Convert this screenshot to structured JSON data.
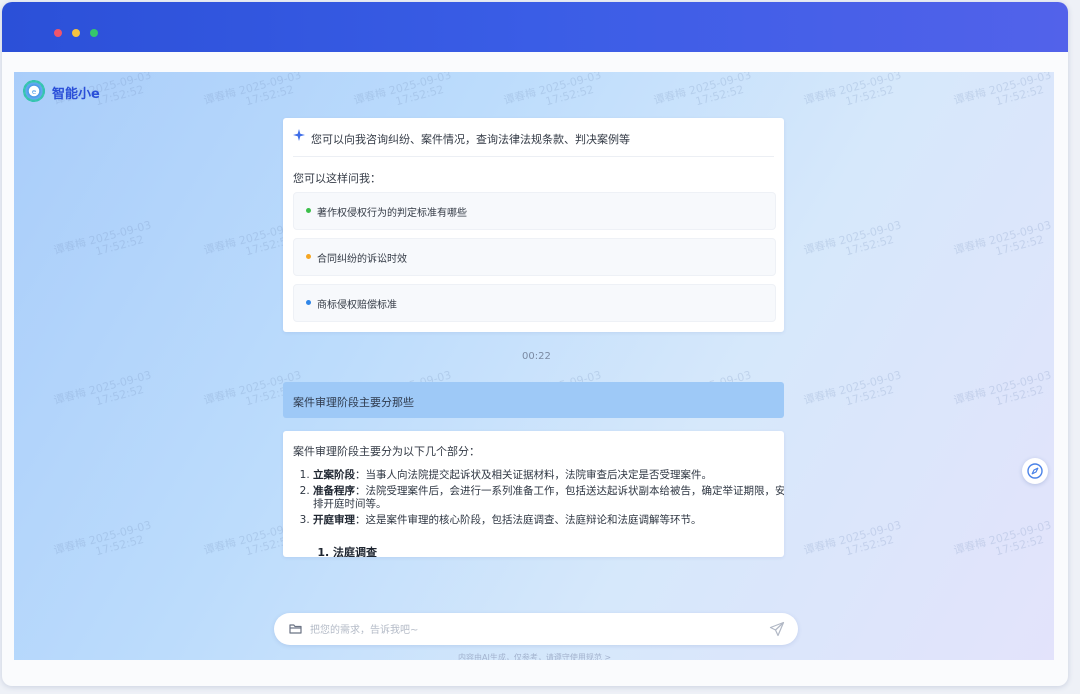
{
  "window": {
    "controls": [
      "close",
      "minimize",
      "maximize"
    ]
  },
  "app": {
    "brand": "智能小e",
    "logo_icon": "swirl-logo-icon"
  },
  "intro_card": {
    "headline": "您可以向我咨询纠纷、案件情况，查询法律法规条款、判决案例等",
    "prompt": "您可以这样问我：",
    "suggestions": [
      {
        "label": "著作权侵权行为的判定标准有哪些",
        "bullet_color": "#3bbf4a"
      },
      {
        "label": "合同纠纷的诉讼时效",
        "bullet_color": "#f5a623"
      },
      {
        "label": "商标侵权赔偿标准",
        "bullet_color": "#2f86e8"
      }
    ]
  },
  "timestamp": "00:22",
  "user_message": "案件审理阶段主要分那些",
  "answer": {
    "intro": "案件审理阶段主要分为以下几个部分：",
    "items": [
      {
        "title": "立案阶段",
        "text": "：当事人向法院提交起诉状及相关证据材料，法院审查后决定是否受理案件。"
      },
      {
        "title": "准备程序",
        "text": "：法院受理案件后，会进行一系列准备工作，包括送达起诉状副本给被告，确定举证期限，安排开庭时间等。"
      },
      {
        "title": "开庭审理",
        "text": "：这是案件审理的核心阶段，包括法庭调查、法庭辩论和法庭调解等环节。"
      }
    ],
    "sub_items": [
      "法庭调查"
    ]
  },
  "input": {
    "placeholder": "把您的需求，告诉我吧~"
  },
  "disclaimer": "内容由AI生成，仅参考，请遵守使用规范 >",
  "watermark": {
    "name": "谭春梅",
    "date": "2025-09-03",
    "time": "17:52:52"
  },
  "colors": {
    "brand": "#2a4fd8",
    "titlebar": "#3a5de6",
    "user_bubble": "#9ec9f7"
  }
}
